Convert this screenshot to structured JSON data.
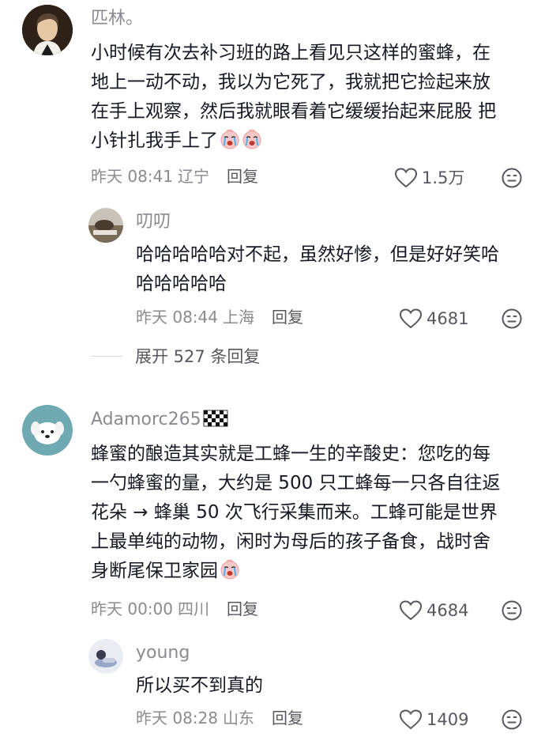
{
  "comments": [
    {
      "username": "匹林。",
      "lines": [
        "小时候有次去补习班的路上看见只这样的蜜蜂，在",
        "地上一动不动，我以为它死了，我就把它捡起来放",
        "在手上观察，然后我就眼看着它缓缓抬起来屁股 把",
        "小针扎我手上了"
      ],
      "emoji": "crying-face-emoji",
      "time": "昨天 08:41",
      "location": "辽宁",
      "reply_label": "回复",
      "likes": "1.5万",
      "reply": {
        "username": "叨叨",
        "lines": [
          "哈哈哈哈哈对不起，虽然好惨，但是好好笑哈",
          "哈哈哈哈哈"
        ],
        "time": "昨天 08:44",
        "location": "上海",
        "reply_label": "回复",
        "likes": "4681"
      },
      "expand_label": "展开 527 条回复"
    },
    {
      "username": "Adamorc265",
      "badge": "checkered-flag-emoji",
      "lines": [
        "蜂蜜的酿造其实就是工蜂一生的辛酸史：您吃的每",
        "一勺蜂蜜的量，大约是 500 只工蜂每一只各自往返",
        "花朵 → 蜂巢 50 次飞行采集而来。工蜂可能是世界",
        "上最单纯的动物，闲时为母后的孩子备食，战时舍",
        "身断尾保卫家园"
      ],
      "emoji": "crying-face-emoji",
      "time": "昨天 00:00",
      "location": "四川",
      "reply_label": "回复",
      "likes": "4684",
      "reply": {
        "username": "young",
        "lines": [
          "所以买不到真的"
        ],
        "time": "昨天 08:28",
        "location": "山东",
        "reply_label": "回复",
        "likes": "1409"
      }
    }
  ],
  "colors": {
    "text": "#161823",
    "secondary": "#8a8b91",
    "action": "#57585f",
    "background": "#ffffff"
  },
  "icons": [
    "heart-outline-icon",
    "dislike-face-icon"
  ]
}
